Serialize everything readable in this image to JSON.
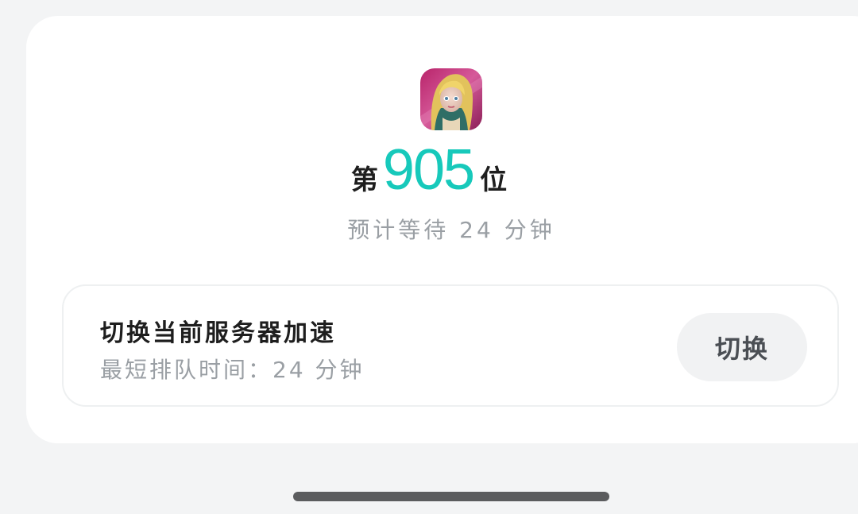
{
  "queue": {
    "rank_prefix": "第",
    "rank_number": "905",
    "rank_suffix": "位",
    "wait_text": "预计等待 24 分钟",
    "rank_color": "#17c9bb"
  },
  "game": {
    "icon": "game-character-avatar-icon"
  },
  "server": {
    "title": "切换当前服务器加速",
    "subtitle": "最短排队时间：24 分钟",
    "switch_label": "切换"
  }
}
